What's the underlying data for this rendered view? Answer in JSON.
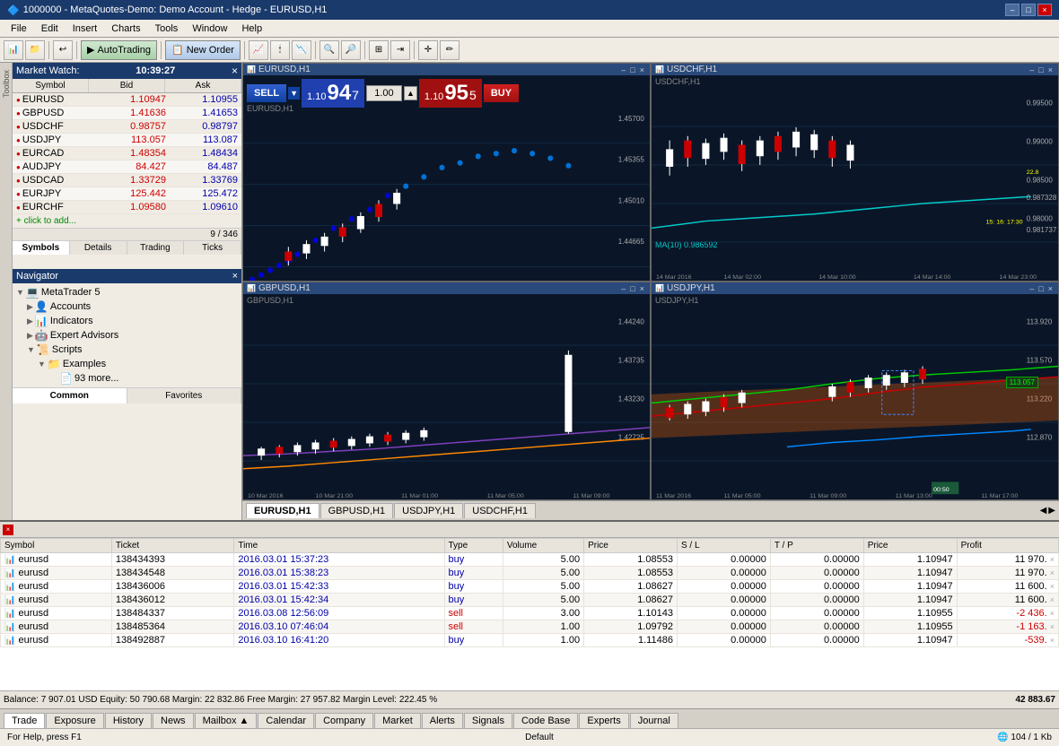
{
  "window": {
    "title": "1000000 - MetaQuotes-Demo: Demo Account - Hedge - EURUSD,H1",
    "controls": [
      "–",
      "□",
      "×"
    ]
  },
  "menu": {
    "items": [
      "File",
      "Edit",
      "Insert",
      "Charts",
      "Tools",
      "Window",
      "Help"
    ]
  },
  "toolbar": {
    "autotrading": "AutoTrading",
    "neworder": "New Order"
  },
  "market_watch": {
    "title": "Market Watch",
    "time": "10:39:27",
    "columns": [
      "Symbol",
      "Bid",
      "Ask"
    ],
    "symbols": [
      {
        "name": "EURUSD",
        "bid": "1.10947",
        "ask": "1.10955",
        "color": "red"
      },
      {
        "name": "GBPUSD",
        "bid": "1.41636",
        "ask": "1.41653",
        "color": "red"
      },
      {
        "name": "USDCHF",
        "bid": "0.98757",
        "ask": "0.98797",
        "color": "red"
      },
      {
        "name": "USDJPY",
        "bid": "113.057",
        "ask": "113.087",
        "color": "red"
      },
      {
        "name": "EURCAD",
        "bid": "1.48354",
        "ask": "1.48434",
        "color": "red"
      },
      {
        "name": "AUDJPY",
        "bid": "84.427",
        "ask": "84.487",
        "color": "red"
      },
      {
        "name": "USDCAD",
        "bid": "1.33729",
        "ask": "1.33769",
        "color": "red"
      },
      {
        "name": "EURJPY",
        "bid": "125.442",
        "ask": "125.472",
        "color": "red"
      },
      {
        "name": "EURCHF",
        "bid": "1.09580",
        "ask": "1.09610",
        "color": "red"
      }
    ],
    "add_label": "+ click to add...",
    "status": "9 / 346",
    "tabs": [
      "Symbols",
      "Details",
      "Trading",
      "Ticks"
    ]
  },
  "navigator": {
    "title": "Navigator",
    "tree": [
      {
        "label": "MetaTrader 5",
        "indent": 0,
        "expand": "▼"
      },
      {
        "label": "Accounts",
        "indent": 1,
        "expand": "▶"
      },
      {
        "label": "Indicators",
        "indent": 1,
        "expand": "▶"
      },
      {
        "label": "Expert Advisors",
        "indent": 1,
        "expand": "▶"
      },
      {
        "label": "Scripts",
        "indent": 1,
        "expand": "▼"
      },
      {
        "label": "Examples",
        "indent": 2,
        "expand": "▼"
      },
      {
        "label": "93 more...",
        "indent": 3
      }
    ],
    "tabs": [
      "Common",
      "Favorites"
    ]
  },
  "charts": {
    "windows": [
      {
        "id": "eurusd",
        "title": "EURUSD,H1",
        "inner_title": "EURUSD,H1"
      },
      {
        "id": "usdchf",
        "title": "USDCHF,H1",
        "inner_title": "USDCHF,H1"
      },
      {
        "id": "gbpusd",
        "title": "GBPUSD,H1",
        "inner_title": "GBPUSD,H1"
      },
      {
        "id": "usdjpy",
        "title": "USDJPY,H1",
        "inner_title": "USDJPY,H1"
      }
    ],
    "tabs": [
      "EURUSD,H1",
      "GBPUSD,H1",
      "USDJPY,H1",
      "USDCHF,H1"
    ]
  },
  "trading": {
    "sell_label": "SELL",
    "buy_label": "BUY",
    "lot": "1.00",
    "sell_price_big": "94",
    "sell_price_small": "7",
    "sell_price_prefix": "1.10",
    "buy_price_big": "95",
    "buy_price_small": "5",
    "buy_price_prefix": "1.10"
  },
  "orders": {
    "columns": [
      "Symbol",
      "Ticket",
      "Time",
      "Type",
      "Volume",
      "Price",
      "S / L",
      "T / P",
      "Price",
      "Profit"
    ],
    "rows": [
      {
        "symbol": "eurusd",
        "ticket": "138434393",
        "time": "2016.03.01 15:37:23",
        "type": "buy",
        "volume": "5.00",
        "open_price": "1.08553",
        "sl": "0.00000",
        "tp": "0.00000",
        "price": "1.10947",
        "profit": "11 970.",
        "profit_neg": false
      },
      {
        "symbol": "eurusd",
        "ticket": "138434548",
        "time": "2016.03.01 15:38:23",
        "type": "buy",
        "volume": "5.00",
        "open_price": "1.08553",
        "sl": "0.00000",
        "tp": "0.00000",
        "price": "1.10947",
        "profit": "11 970.",
        "profit_neg": false
      },
      {
        "symbol": "eurusd",
        "ticket": "138436006",
        "time": "2016.03.01 15:42:33",
        "type": "buy",
        "volume": "5.00",
        "open_price": "1.08627",
        "sl": "0.00000",
        "tp": "0.00000",
        "price": "1.10947",
        "profit": "11 600.",
        "profit_neg": false
      },
      {
        "symbol": "eurusd",
        "ticket": "138436012",
        "time": "2016.03.01 15:42:34",
        "type": "buy",
        "volume": "5.00",
        "open_price": "1.08627",
        "sl": "0.00000",
        "tp": "0.00000",
        "price": "1.10947",
        "profit": "11 600.",
        "profit_neg": false
      },
      {
        "symbol": "eurusd",
        "ticket": "138484337",
        "time": "2016.03.08 12:56:09",
        "type": "sell",
        "volume": "3.00",
        "open_price": "1.10143",
        "sl": "0.00000",
        "tp": "0.00000",
        "price": "1.10955",
        "profit": "-2 436.",
        "profit_neg": true
      },
      {
        "symbol": "eurusd",
        "ticket": "138485364",
        "time": "2016.03.10 07:46:04",
        "type": "sell",
        "volume": "1.00",
        "open_price": "1.09792",
        "sl": "0.00000",
        "tp": "0.00000",
        "price": "1.10955",
        "profit": "-1 163.",
        "profit_neg": true
      },
      {
        "symbol": "eurusd",
        "ticket": "138492887",
        "time": "2016.03.10 16:41:20",
        "type": "buy",
        "volume": "1.00",
        "open_price": "1.11486",
        "sl": "0.00000",
        "tp": "0.00000",
        "price": "1.10947",
        "profit": "-539.",
        "profit_neg": true
      }
    ],
    "balance_info": "Balance: 7 907.01 USD   Equity: 50 790.68   Margin: 22 832.86   Free Margin: 27 957.82   Margin Level: 222.45 %",
    "total_profit": "42 883.67"
  },
  "bottom_tabs": [
    "Trade",
    "Exposure",
    "History",
    "News",
    "Mailbox ▲",
    "Calendar",
    "Company",
    "Market",
    "Alerts",
    "Signals",
    "Code Base",
    "Experts",
    "Journal"
  ],
  "footer": {
    "left": "For Help, press F1",
    "center": "Default",
    "right": "🌐 104 / 1 Kb"
  },
  "usdchf_ma": "MA(10) 0.986592",
  "usdjpy_time": "00:50"
}
